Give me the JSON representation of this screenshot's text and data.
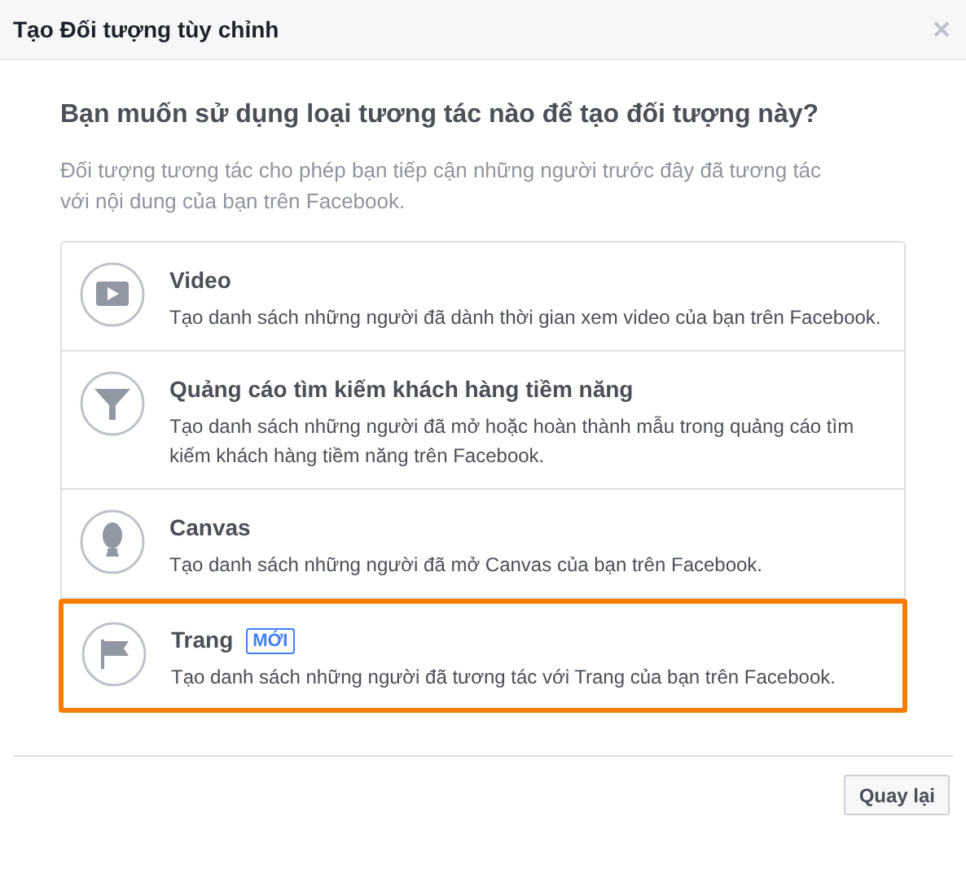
{
  "dialog": {
    "title": "Tạo Đối tượng tùy chỉnh"
  },
  "question": "Bạn muốn sử dụng loại tương tác nào để tạo đối tượng này?",
  "description": "Đối tượng tương tác cho phép bạn tiếp cận những người trước đây đã tương tác với nội dung của bạn trên Facebook.",
  "options": [
    {
      "kind": "video",
      "title": "Video",
      "text": "Tạo danh sách những người đã dành thời gian xem video của bạn trên Facebook.",
      "selected": false
    },
    {
      "kind": "lead",
      "title": "Quảng cáo tìm kiếm khách hàng tiềm năng",
      "text": "Tạo danh sách những người đã mở hoặc hoàn thành mẫu trong quảng cáo tìm kiếm khách hàng tiềm năng trên Facebook.",
      "selected": false
    },
    {
      "kind": "canvas",
      "title": "Canvas",
      "text": "Tạo danh sách những người đã mở Canvas của bạn trên Facebook.",
      "selected": false
    },
    {
      "kind": "page",
      "title": "Trang",
      "badge": "MỚI",
      "text": "Tạo danh sách những người đã tương tác với Trang của bạn trên Facebook.",
      "selected": true
    }
  ],
  "buttons": [
    "Quay lại"
  ]
}
